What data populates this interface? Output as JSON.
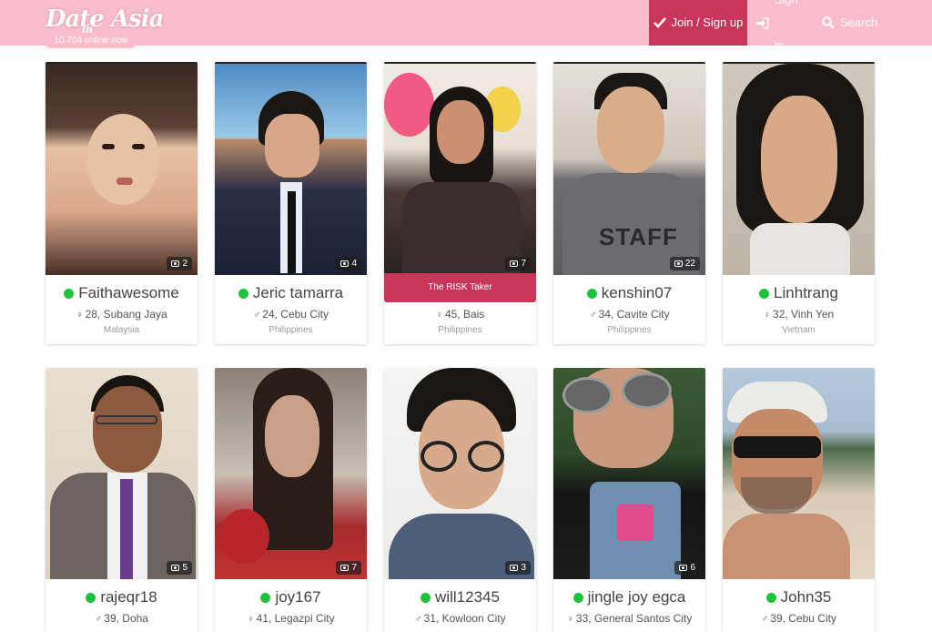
{
  "header": {
    "logo": {
      "line1": "Date",
      "line2": "in",
      "line3": "Asia"
    },
    "online_count": "10 704 online now",
    "nav": {
      "join": "Join / Sign up",
      "signin": "Sign in",
      "search": "Search"
    }
  },
  "colors": {
    "header_bg": "#f9bccb",
    "accent": "#c8365c",
    "online": "#1cc43a"
  },
  "profiles": [
    {
      "name": "Faithawesome",
      "gender": "female",
      "age_city": "28, Subang Jaya",
      "country": "Malaysia",
      "photos": "2",
      "online": true
    },
    {
      "name": "Jeric tamarra",
      "gender": "male",
      "age_city": "24, Cebu City",
      "country": "Philippines",
      "photos": "4",
      "online": true
    },
    {
      "name": "The RISK Taker",
      "gender": "female",
      "age_city": "45, Bais",
      "country": "Philippines",
      "photos": "7",
      "online": false
    },
    {
      "name": "kenshin07",
      "gender": "male",
      "age_city": "34, Cavite City",
      "country": "Philippines",
      "photos": "22",
      "online": true
    },
    {
      "name": "Linhtrang",
      "gender": "female",
      "age_city": "32, Vinh Yen",
      "country": "Vietnam",
      "photos": "",
      "online": true
    },
    {
      "name": "rajeqr18",
      "gender": "male",
      "age_city": "39, Doha",
      "country": "",
      "photos": "5",
      "online": true
    },
    {
      "name": "joy167",
      "gender": "female",
      "age_city": "41, Legazpi City",
      "country": "",
      "photos": "7",
      "online": true
    },
    {
      "name": "will12345",
      "gender": "male",
      "age_city": "31, Kowloon City",
      "country": "",
      "photos": "3",
      "online": true
    },
    {
      "name": "jingle joy egca",
      "gender": "female",
      "age_city": "33, General Santos City",
      "country": "",
      "photos": "6",
      "online": true
    },
    {
      "name": "John35",
      "gender": "male",
      "age_city": "39, Cebu City",
      "country": "",
      "photos": "",
      "online": true
    }
  ]
}
